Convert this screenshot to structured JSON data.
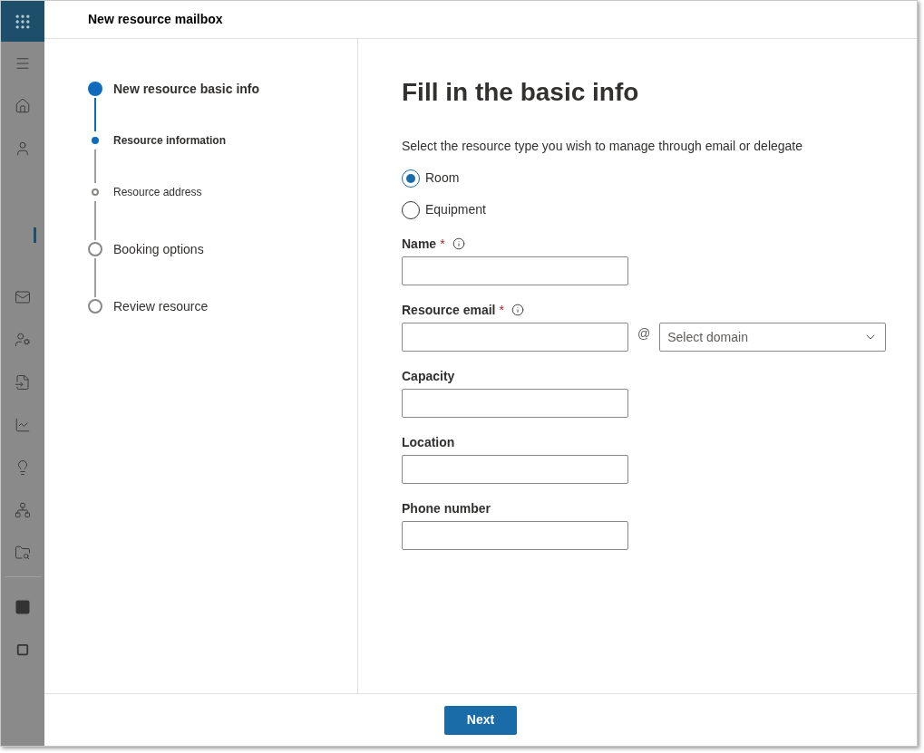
{
  "panel": {
    "title": "New resource mailbox"
  },
  "steps": [
    {
      "kind": "step",
      "label": "New resource basic info",
      "active": true
    },
    {
      "kind": "substep",
      "label": "Resource information",
      "active": true
    },
    {
      "kind": "substep",
      "label": "Resource address",
      "active": false
    },
    {
      "kind": "step",
      "label": "Booking options",
      "active": false
    },
    {
      "kind": "step",
      "label": "Review resource",
      "active": false
    }
  ],
  "form": {
    "heading": "Fill in the basic info",
    "prompt": "Select the resource type you wish to manage through email or delegate",
    "resource_types": [
      {
        "label": "Room",
        "selected": true
      },
      {
        "label": "Equipment",
        "selected": false
      }
    ],
    "fields": [
      {
        "kind": "text",
        "label": "Name",
        "required_mark": "*",
        "info": true
      },
      {
        "kind": "email",
        "label": "Resource email",
        "required_mark": "*",
        "info": true,
        "at": "@",
        "domain_placeholder": "Select domain"
      },
      {
        "kind": "text",
        "label": "Capacity",
        "info": false
      },
      {
        "kind": "text",
        "label": "Location",
        "info": false
      },
      {
        "kind": "text",
        "label": "Phone number",
        "info": false
      }
    ]
  },
  "footer": {
    "next_button": "Next"
  }
}
